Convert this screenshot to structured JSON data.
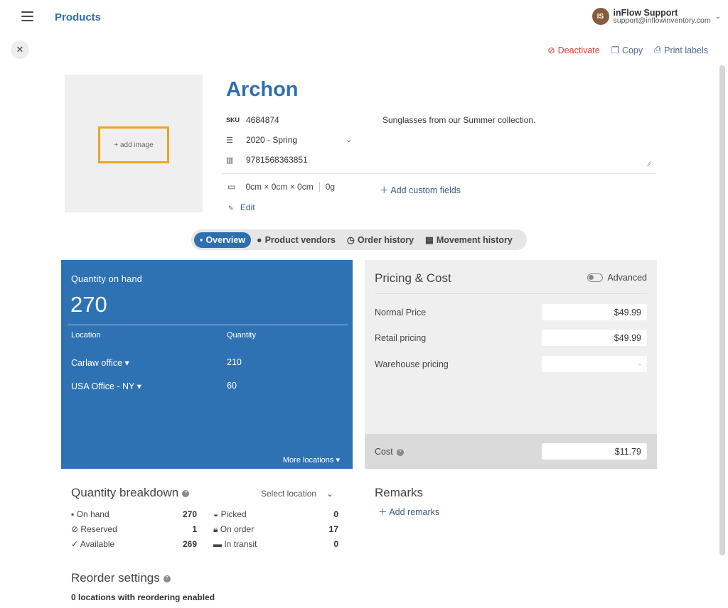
{
  "header": {
    "app_title": "Products",
    "user": {
      "initials": "IS",
      "name": "inFlow Support",
      "email": "support@inflowinventory.com"
    }
  },
  "actions": {
    "deactivate": "Deactivate",
    "copy": "Copy",
    "print": "Print labels"
  },
  "product": {
    "image_placeholder": "+ add image",
    "name": "Archon",
    "sku_label": "SKU",
    "sku": "4684874",
    "category": "2020 - Spring",
    "barcode": "9781568363851",
    "description": "Sunglasses from our Summer collection.",
    "dims": "0cm × 0cm × 0cm",
    "weight": "0g",
    "add_custom": "Add custom fields",
    "edit": "Edit"
  },
  "tabs": [
    {
      "label": "Overview",
      "icon": "box-icon"
    },
    {
      "label": "Product vendors",
      "icon": "person-icon"
    },
    {
      "label": "Order history",
      "icon": "clock-icon"
    },
    {
      "label": "Movement history",
      "icon": "calendar-icon"
    }
  ],
  "qoh": {
    "title": "Quantity on hand",
    "total": "270",
    "col_location": "Location",
    "col_quantity": "Quantity",
    "rows": [
      {
        "location": "Carlaw office ▾",
        "qty": "210"
      },
      {
        "location": "USA Office - NY ▾",
        "qty": "60"
      }
    ],
    "more": "More locations ▾"
  },
  "pricing": {
    "title": "Pricing & Cost",
    "advanced": "Advanced",
    "rows": [
      {
        "label": "Normal Price",
        "value": "$49.99"
      },
      {
        "label": "Retail pricing",
        "value": "$49.99"
      },
      {
        "label": "Warehouse pricing",
        "value": "-"
      }
    ],
    "cost_label": "Cost",
    "cost_value": "$11.79"
  },
  "breakdown": {
    "title": "Quantity breakdown",
    "select": "Select location",
    "left": [
      {
        "label": "On hand",
        "value": "270",
        "icon": "box-icon"
      },
      {
        "label": "Reserved",
        "value": "1",
        "icon": "ban-icon"
      },
      {
        "label": "Available",
        "value": "269",
        "icon": "check-icon"
      }
    ],
    "right": [
      {
        "label": "Picked",
        "value": "0",
        "icon": "basket-icon"
      },
      {
        "label": "On order",
        "value": "17",
        "icon": "lock-icon"
      },
      {
        "label": "In transit",
        "value": "0",
        "icon": "truck-icon"
      }
    ]
  },
  "remarks": {
    "title": "Remarks",
    "add": "Add remarks"
  },
  "reorder": {
    "title": "Reorder settings",
    "summary": "0 locations with reordering enabled"
  }
}
